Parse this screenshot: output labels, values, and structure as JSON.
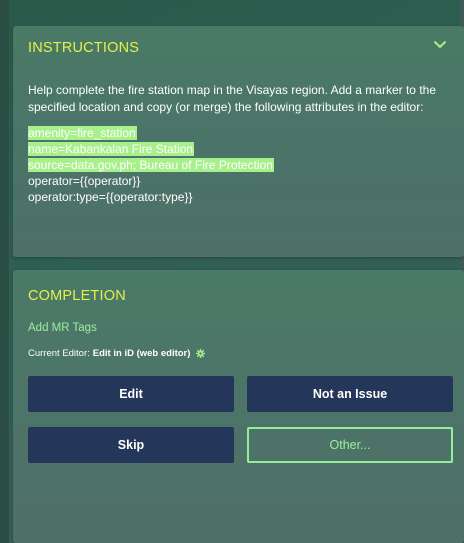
{
  "instructions": {
    "title": "INSTRUCTIONS",
    "collapse_icon": "chevron-down-icon",
    "body": "Help complete the fire station map in the Visayas region. Add a marker to the specified location and copy (or merge) the following attributes in the editor:",
    "highlighted_tags": [
      "amenity=fire_station",
      "name=Kabankalan Fire Station",
      "source=data.gov.ph; Bureau of Fire Protection"
    ],
    "plain_tags": [
      "operator={{operator}}",
      "operator:type={{operator:type}}"
    ]
  },
  "completion": {
    "title": "COMPLETION",
    "add_tags_link": "Add MR Tags",
    "current_editor_label": "Current Editor:",
    "current_editor_value": "Edit in iD (web editor)",
    "editor_settings_icon": "gear-icon",
    "buttons": {
      "edit": "Edit",
      "not_an_issue": "Not an Issue",
      "skip": "Skip",
      "other": "Other..."
    }
  },
  "colors": {
    "title_yellow": "#e4f04a",
    "accent_green": "#9bf09a",
    "tag_highlight": "#a8f08c",
    "button_navy": "#24375a"
  }
}
